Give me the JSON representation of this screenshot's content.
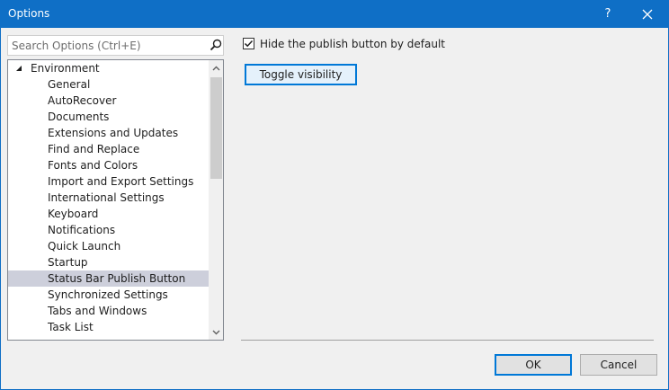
{
  "window": {
    "title": "Options",
    "help_label": "?"
  },
  "search": {
    "placeholder": "Search Options (Ctrl+E)",
    "value": ""
  },
  "tree": {
    "parent": {
      "label": "Environment",
      "expanded": true
    },
    "children": [
      {
        "label": "General"
      },
      {
        "label": "AutoRecover"
      },
      {
        "label": "Documents"
      },
      {
        "label": "Extensions and Updates"
      },
      {
        "label": "Find and Replace"
      },
      {
        "label": "Fonts and Colors"
      },
      {
        "label": "Import and Export Settings"
      },
      {
        "label": "International Settings"
      },
      {
        "label": "Keyboard"
      },
      {
        "label": "Notifications"
      },
      {
        "label": "Quick Launch"
      },
      {
        "label": "Startup"
      },
      {
        "label": "Status Bar Publish Button",
        "selected": true
      },
      {
        "label": "Synchronized Settings"
      },
      {
        "label": "Tabs and Windows"
      },
      {
        "label": "Task List"
      }
    ]
  },
  "panel": {
    "checkbox": {
      "label": "Hide the publish button by default",
      "checked": true
    },
    "toggle_label": "Toggle visibility"
  },
  "footer": {
    "ok_label": "OK",
    "cancel_label": "Cancel"
  },
  "icons": {
    "search": "search-icon",
    "close": "close-icon",
    "expand": "expanded-triangle-icon",
    "scroll_up": "chevron-up-icon",
    "scroll_down": "chevron-down-icon",
    "check": "checkmark-icon"
  },
  "colors": {
    "titlebar": "#0f6fc6",
    "selection": "#cdcfdb",
    "accent": "#0078d7"
  }
}
